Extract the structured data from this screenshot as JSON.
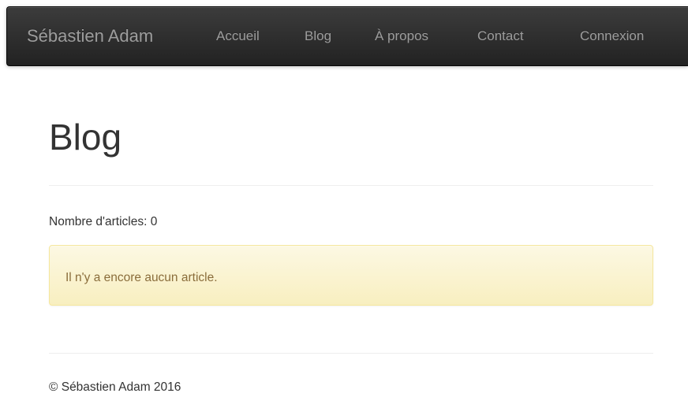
{
  "navbar": {
    "brand": "Sébastien Adam",
    "items": [
      {
        "label": "Accueil"
      },
      {
        "label": "Blog"
      },
      {
        "label": "À propos"
      },
      {
        "label": "Contact"
      },
      {
        "label": "Connexion"
      }
    ]
  },
  "main": {
    "title": "Blog",
    "article_count_text": "Nombre d'articles: 0",
    "alert_text": "Il n'y a encore aucun article."
  },
  "footer": {
    "copyright": "© Sébastien Adam 2016"
  },
  "colors": {
    "navbar_dark": "#222222",
    "nav_text": "#9d9d9d",
    "alert_background": "#fcf8e3",
    "alert_text": "#8a6d3b"
  }
}
